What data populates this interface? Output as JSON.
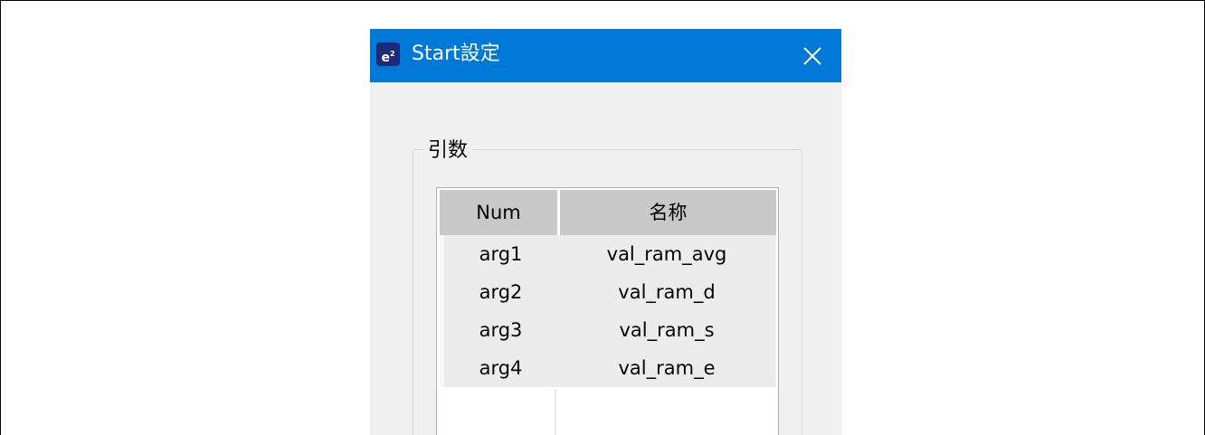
{
  "window": {
    "title": "Start設定",
    "icon": "e2-studio-app-icon",
    "close_icon": "close-icon",
    "titlebar_color": "#0078d7",
    "body_color": "#f0f0f0"
  },
  "group": {
    "label": "引数"
  },
  "table": {
    "columns": [
      "Num",
      "名称"
    ],
    "rows": [
      {
        "num": "arg1",
        "name": "val_ram_avg"
      },
      {
        "num": "arg2",
        "name": "val_ram_d"
      },
      {
        "num": "arg3",
        "name": "val_ram_s"
      },
      {
        "num": "arg4",
        "name": "val_ram_e"
      }
    ]
  }
}
